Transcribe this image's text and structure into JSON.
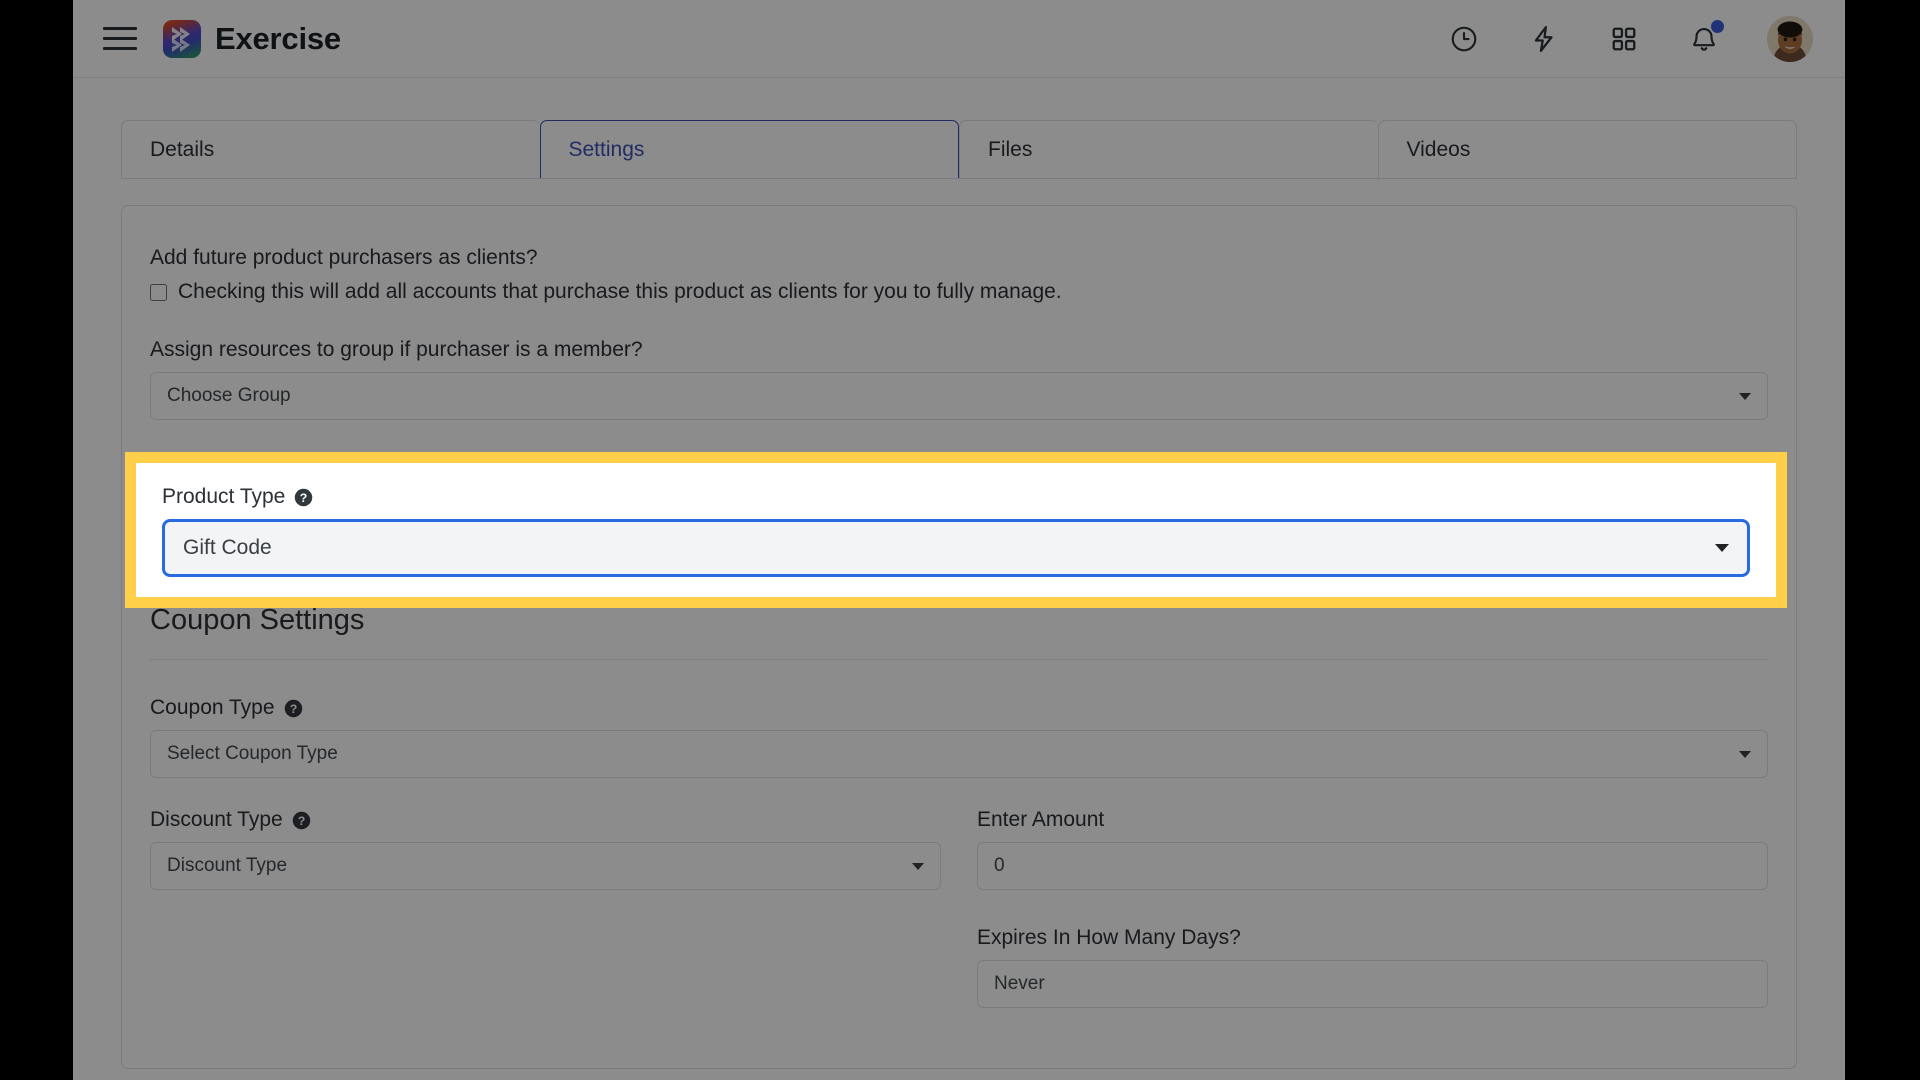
{
  "header": {
    "menu_label": "menu",
    "brand_name": "Exercise",
    "icons": [
      {
        "name": "clock-icon",
        "label": "Recent Activity"
      },
      {
        "name": "lightning-icon",
        "label": "Quick Actions"
      },
      {
        "name": "grid-icon",
        "label": "Apps"
      },
      {
        "name": "bell-icon",
        "label": "Notifications"
      }
    ],
    "has_notification": true,
    "notification_dot_color": "#3b5bdb",
    "avatar_label": "User Avatar"
  },
  "tabs": [
    {
      "label": "Details",
      "active": false
    },
    {
      "label": "Settings",
      "active": true
    },
    {
      "label": "Files",
      "active": false
    },
    {
      "label": "Videos",
      "active": false
    }
  ],
  "form": {
    "clients_question": "Add future product purchasers as clients?",
    "clients_checkbox_label": "Checking this will add all accounts that purchase this product as clients for you to fully manage.",
    "clients_checkbox_checked": false,
    "assign_group_question": "Assign resources to group if purchaser is a member?",
    "choose_group_value": "Choose Group",
    "product_type_label": "Product Type",
    "product_type_value": "Gift Code",
    "coupon_settings_title": "Coupon Settings",
    "coupon_type_label": "Coupon Type",
    "coupon_type_value": "Select Coupon Type",
    "discount_type_label": "Discount Type",
    "discount_type_value": "Discount Type",
    "enter_amount_label": "Enter Amount",
    "enter_amount_value": "0",
    "expires_label": "Expires In How Many Days?",
    "expires_value": "Never"
  },
  "highlight": {
    "border_color": "#ffcf4a",
    "focus_border_color": "#2a6ae0",
    "accent_color": "#3f51b5"
  }
}
